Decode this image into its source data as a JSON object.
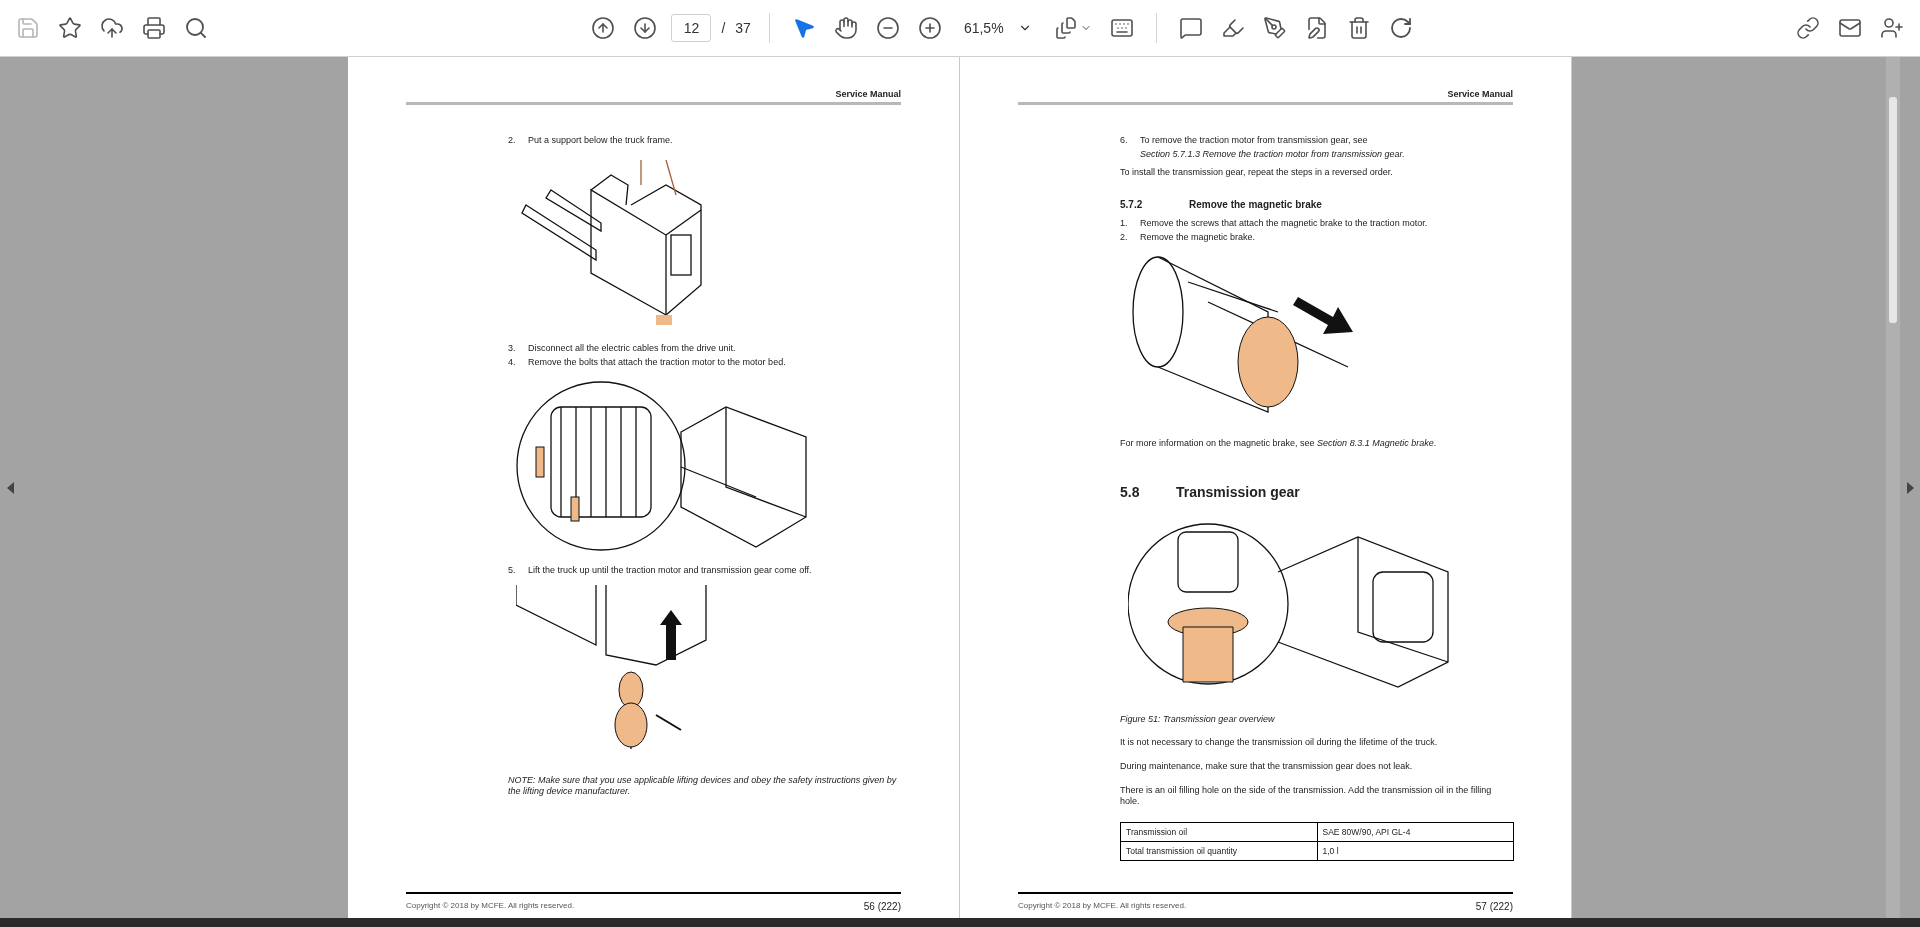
{
  "toolbar": {
    "save_disabled": true,
    "page_number": "12",
    "separator": "/",
    "page_count": "37",
    "zoom": "61,5%",
    "tools": [
      {
        "selected": true
      },
      {
        "selected": false
      }
    ]
  },
  "pages": [
    {
      "header": "Service Manual",
      "blocks": [
        {
          "kind": "step",
          "number": "2.",
          "text": "Put a support below the truck frame."
        },
        {
          "kind": "figure"
        },
        {
          "kind": "step",
          "number": "3.",
          "text": "Disconnect all the electric cables from the drive unit."
        },
        {
          "kind": "step",
          "number": "4.",
          "text": "Remove the bolts that attach the traction motor to the motor bed."
        },
        {
          "kind": "figure"
        },
        {
          "kind": "step",
          "number": "5.",
          "text": "Lift the truck up until the traction motor and transmission gear come off."
        },
        {
          "kind": "figure"
        },
        {
          "kind": "note",
          "text": "NOTE: Make sure that you use applicable lifting devices and obey the safety instructions given by the lifting device manufacturer."
        }
      ],
      "copyright": "Copyright © 2018 by MCFE. All rights reserved.",
      "page_number": "56 (222)"
    },
    {
      "header": "Service Manual",
      "blocks": [
        {
          "kind": "step",
          "number": "6.",
          "text": "To remove the traction motor from transmission gear, see",
          "reference": "Section 5.7.1.3 Remove the traction motor from transmission gear."
        },
        {
          "kind": "paragraph",
          "text": "To install the transmission gear, repeat the steps in a reversed order."
        },
        {
          "kind": "subheading",
          "number": "5.7.2",
          "text": "Remove the magnetic brake"
        },
        {
          "kind": "step",
          "number": "1.",
          "text": "Remove the screws that attach the magnetic brake to the traction motor."
        },
        {
          "kind": "step",
          "number": "2.",
          "text": "Remove the magnetic brake."
        },
        {
          "kind": "figure"
        },
        {
          "kind": "paragraph",
          "text": "For more information on the magnetic brake, see *Section 8.3.1 Magnetic brake*."
        },
        {
          "kind": "heading",
          "number": "5.8",
          "text": "Transmission gear"
        },
        {
          "kind": "figure"
        },
        {
          "kind": "caption",
          "text": "Figure 51: Transmission gear overview"
        },
        {
          "kind": "paragraph",
          "text": "It is not necessary to change the transmission oil during the lifetime of the truck."
        },
        {
          "kind": "paragraph",
          "text": "During maintenance, make sure that the transmission gear does not leak."
        },
        {
          "kind": "paragraph",
          "text": "There is an oil filling hole on the side of the transmission. Add the transmission oil in the filling hole."
        },
        {
          "kind": "table",
          "rows": [
            [
              "Transmission oil",
              "SAE 80W/90, API GL-4"
            ],
            [
              "Total transmission oil quantity",
              "1,0 l"
            ]
          ]
        }
      ],
      "copyright": "Copyright © 2018 by MCFE. All rights reserved.",
      "page_number": "57 (222)"
    }
  ]
}
